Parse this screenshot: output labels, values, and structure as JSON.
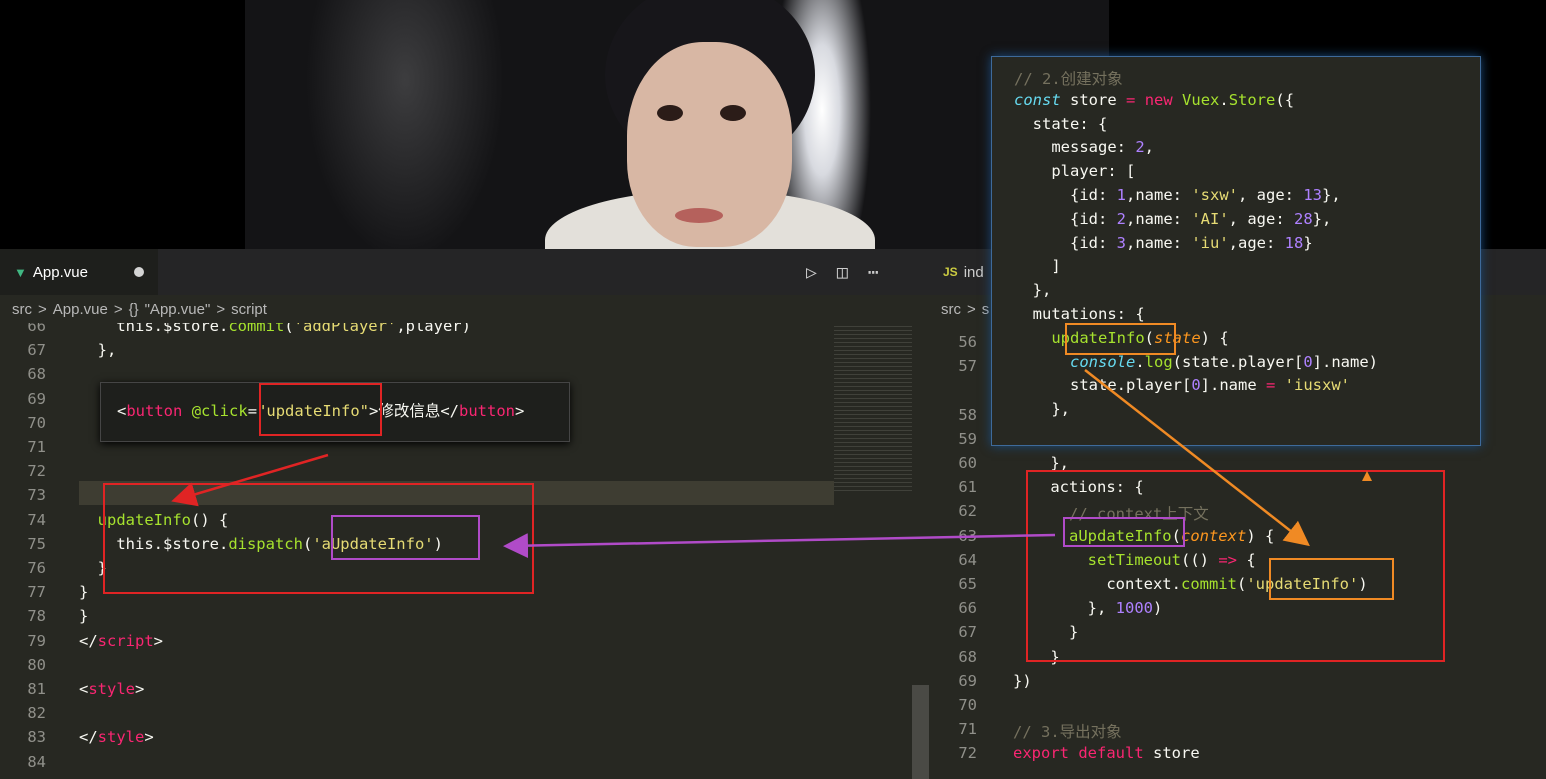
{
  "left": {
    "tab": "App.vue",
    "crumbs": [
      "src",
      ">",
      "App.vue",
      ">",
      "{}",
      "\"App.vue\"",
      ">",
      "script"
    ],
    "lines": [
      {
        "n": "66",
        "segs": [
          [
            "t",
            "    "
          ],
          [
            "t",
            "this"
          ],
          [
            "t",
            ".$store."
          ],
          [
            "f",
            "commit"
          ],
          [
            "t",
            "("
          ],
          [
            "s",
            "'addPlayer'"
          ],
          [
            "t",
            ",player)"
          ]
        ]
      },
      {
        "n": "67",
        "segs": [
          [
            "t",
            "  },"
          ]
        ]
      },
      {
        "n": "68",
        "segs": []
      },
      {
        "n": "69",
        "segs": []
      },
      {
        "n": "70",
        "segs": []
      },
      {
        "n": "71",
        "segs": []
      },
      {
        "n": "72",
        "segs": []
      },
      {
        "n": "73",
        "segs": []
      },
      {
        "n": "74",
        "segs": [
          [
            "f",
            "  updateInfo"
          ],
          [
            "t",
            "() {"
          ]
        ]
      },
      {
        "n": "75",
        "segs": [
          [
            "t",
            "    this.$store."
          ],
          [
            "f",
            "dispatch"
          ],
          [
            "t",
            "("
          ],
          [
            "s",
            "'aUpdateInfo'"
          ],
          [
            "t",
            ")"
          ]
        ]
      },
      {
        "n": "76",
        "segs": [
          [
            "t",
            "  }"
          ]
        ]
      },
      {
        "n": "77",
        "segs": [
          [
            "t",
            "}"
          ]
        ]
      },
      {
        "n": "78",
        "segs": [
          [
            "t",
            "}"
          ]
        ]
      },
      {
        "n": "79",
        "segs": [
          [
            "t",
            "</"
          ],
          [
            "k",
            "script"
          ],
          [
            "t",
            ">"
          ]
        ]
      },
      {
        "n": "80",
        "segs": []
      },
      {
        "n": "81",
        "segs": [
          [
            "t",
            "<"
          ],
          [
            "k",
            "style"
          ],
          [
            "t",
            ">"
          ]
        ]
      },
      {
        "n": "82",
        "segs": []
      },
      {
        "n": "83",
        "segs": [
          [
            "t",
            "</"
          ],
          [
            "k",
            "style"
          ],
          [
            "t",
            ">"
          ]
        ]
      },
      {
        "n": "84",
        "segs": []
      }
    ],
    "popup": [
      [
        "t",
        "<"
      ],
      [
        "k",
        "button"
      ],
      [
        "t",
        " "
      ],
      [
        "f",
        "@click"
      ],
      [
        "t",
        "="
      ],
      [
        "s",
        "\"updateInfo\""
      ],
      [
        "t",
        ">修改信息</"
      ],
      [
        "k",
        "button"
      ],
      [
        "t",
        ">"
      ]
    ]
  },
  "right": {
    "tab": "ind",
    "tab_icon": "JS",
    "crumbs": [
      "src",
      ">",
      "s"
    ],
    "lines": [
      {
        "n": "56",
        "segs": []
      },
      {
        "n": "57",
        "segs": []
      },
      {
        "n": "",
        "segs": []
      },
      {
        "n": "58",
        "segs": []
      },
      {
        "n": "59",
        "segs": []
      },
      {
        "n": "60",
        "segs": [
          [
            "t",
            "    },"
          ]
        ]
      },
      {
        "n": "61",
        "segs": [
          [
            "t",
            "    actions: {"
          ]
        ]
      },
      {
        "n": "62",
        "segs": [
          [
            "c",
            "      // context上下文"
          ]
        ]
      },
      {
        "n": "63",
        "segs": [
          [
            "f",
            "      aUpdateInfo"
          ],
          [
            "t",
            "("
          ],
          [
            "p",
            "context"
          ],
          [
            "t",
            ") {"
          ]
        ]
      },
      {
        "n": "64",
        "segs": [
          [
            "f",
            "        setTimeout"
          ],
          [
            "t",
            "(() "
          ],
          [
            "k",
            "=>"
          ],
          [
            "t",
            " {"
          ]
        ]
      },
      {
        "n": "65",
        "segs": [
          [
            "t",
            "          context."
          ],
          [
            "f",
            "commit"
          ],
          [
            "t",
            "("
          ],
          [
            "s",
            "'updateInfo'"
          ],
          [
            "t",
            ")"
          ]
        ]
      },
      {
        "n": "66",
        "segs": [
          [
            "t",
            "        }, "
          ],
          [
            "n",
            "1000"
          ],
          [
            "t",
            ")"
          ]
        ]
      },
      {
        "n": "67",
        "segs": [
          [
            "t",
            "      }"
          ]
        ]
      },
      {
        "n": "68",
        "segs": [
          [
            "t",
            "    }"
          ]
        ]
      },
      {
        "n": "69",
        "segs": [
          [
            "t",
            "})"
          ]
        ]
      },
      {
        "n": "70",
        "segs": []
      },
      {
        "n": "71",
        "segs": [
          [
            "c",
            "// 3.导出对象"
          ]
        ]
      },
      {
        "n": "72",
        "segs": [
          [
            "k",
            "export default"
          ],
          [
            "t",
            " store"
          ]
        ]
      }
    ]
  },
  "overlay": {
    "lines": [
      [
        [
          "c",
          "// 2.创建对象"
        ]
      ],
      [
        [
          "i",
          "const"
        ],
        [
          "t",
          " store "
        ],
        [
          "k",
          "="
        ],
        [
          "t",
          " "
        ],
        [
          "k",
          "new"
        ],
        [
          "t",
          " "
        ],
        [
          "f",
          "Vuex"
        ],
        [
          "t",
          "."
        ],
        [
          "f",
          "Store"
        ],
        [
          "t",
          "({"
        ]
      ],
      [
        [
          "t",
          "  state: {"
        ]
      ],
      [
        [
          "t",
          "    message: "
        ],
        [
          "n",
          "2"
        ],
        [
          "t",
          ","
        ]
      ],
      [
        [
          "t",
          "    player: ["
        ]
      ],
      [
        [
          "t",
          "      {id: "
        ],
        [
          "n",
          "1"
        ],
        [
          "t",
          ",name: "
        ],
        [
          "s",
          "'sxw'"
        ],
        [
          "t",
          ", age: "
        ],
        [
          "n",
          "13"
        ],
        [
          "t",
          "},"
        ]
      ],
      [
        [
          "t",
          "      {id: "
        ],
        [
          "n",
          "2"
        ],
        [
          "t",
          ",name: "
        ],
        [
          "s",
          "'AI'"
        ],
        [
          "t",
          ", age: "
        ],
        [
          "n",
          "28"
        ],
        [
          "t",
          "},"
        ]
      ],
      [
        [
          "t",
          "      {id: "
        ],
        [
          "n",
          "3"
        ],
        [
          "t",
          ",name: "
        ],
        [
          "s",
          "'iu'"
        ],
        [
          "t",
          ",age: "
        ],
        [
          "n",
          "18"
        ],
        [
          "t",
          "}"
        ]
      ],
      [
        [
          "t",
          "    ]"
        ]
      ],
      [
        [
          "t",
          "  },"
        ]
      ],
      [
        [
          "t",
          "  mutations: {"
        ]
      ],
      [
        [
          "f",
          "    updateInfo"
        ],
        [
          "t",
          "("
        ],
        [
          "p",
          "state"
        ],
        [
          "t",
          ") {"
        ]
      ],
      [
        [
          "i",
          "      console"
        ],
        [
          "t",
          "."
        ],
        [
          "f",
          "log"
        ],
        [
          "t",
          "(state.player["
        ],
        [
          "n",
          "0"
        ],
        [
          "t",
          "].name)"
        ]
      ],
      [
        [
          "t",
          "      state.player["
        ],
        [
          "n",
          "0"
        ],
        [
          "t",
          "].name "
        ],
        [
          "k",
          "="
        ],
        [
          "t",
          " "
        ],
        [
          "s",
          "'iusxw'"
        ]
      ],
      [
        [
          "t",
          "    },"
        ]
      ]
    ]
  }
}
